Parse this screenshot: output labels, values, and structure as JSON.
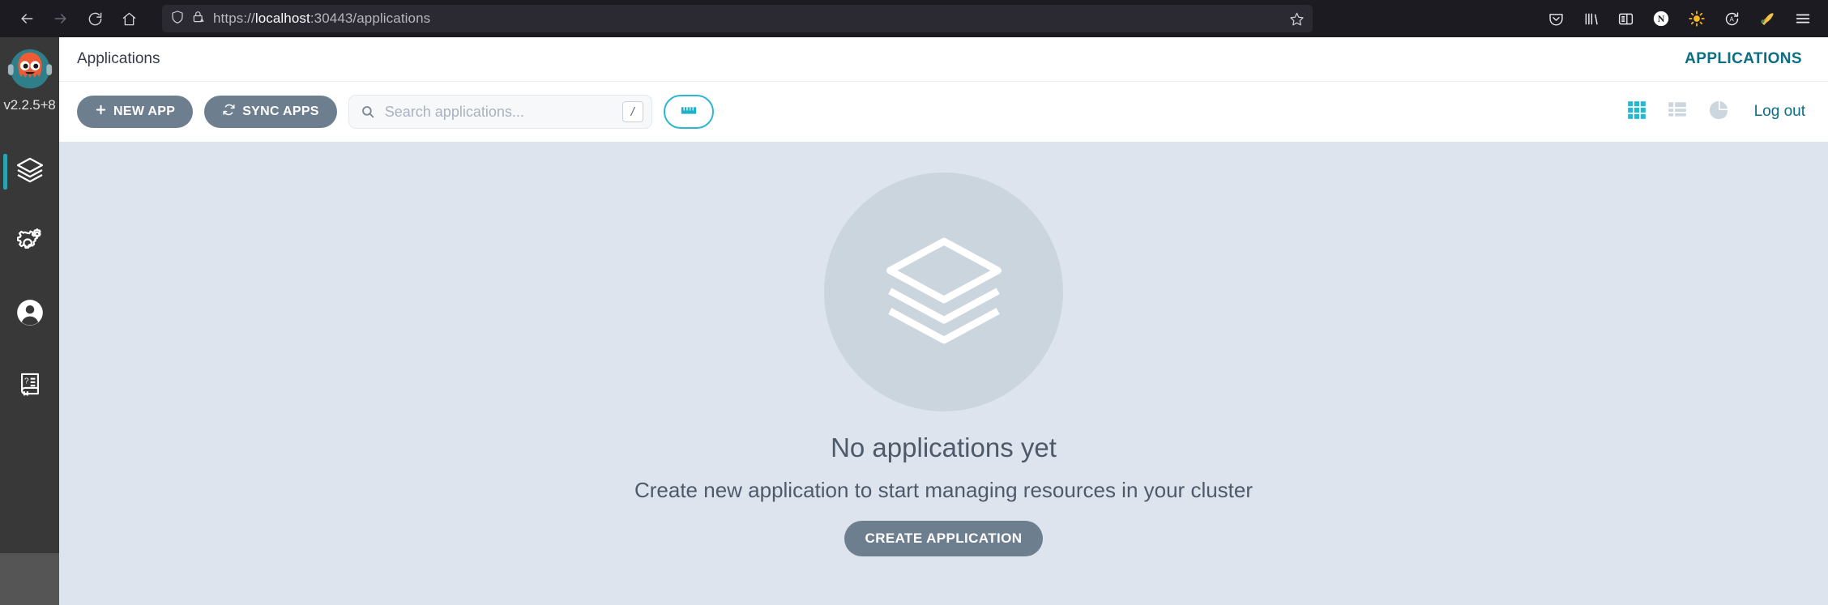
{
  "browser": {
    "back_label": "Back",
    "forward_label": "Forward",
    "reload_label": "Reload",
    "home_label": "Home",
    "url_scheme": "https://",
    "url_host": "localhost",
    "url_path": ":30443/applications",
    "full_url": "https://localhost:30443/applications",
    "bookmark_label": "Bookmark this page",
    "toolbar_icons": [
      {
        "name": "pocket-icon",
        "label": "Save to Pocket"
      },
      {
        "name": "library-icon",
        "label": "Library"
      },
      {
        "name": "sidebar-icon",
        "label": "Sidebars"
      },
      {
        "name": "notion-extension-icon",
        "label": "N"
      },
      {
        "name": "theme-sun-icon",
        "label": "Theme"
      },
      {
        "name": "translate-icon",
        "label": "Translate"
      },
      {
        "name": "extension-icon",
        "label": "Extension"
      },
      {
        "name": "app-menu-icon",
        "label": "Open application menu"
      }
    ]
  },
  "sidebar": {
    "brand": {
      "logo_name": "argo-octopus-logo",
      "version": "v2.2.5+8"
    },
    "items": [
      {
        "label": "Applications",
        "icon": "layers-icon",
        "active": true
      },
      {
        "label": "Settings",
        "icon": "gears-icon",
        "active": false
      },
      {
        "label": "User Info",
        "icon": "user-circle-icon",
        "active": false
      },
      {
        "label": "Documentation",
        "icon": "book-icon",
        "active": false
      }
    ]
  },
  "header": {
    "breadcrumb": "Applications",
    "right_title": "APPLICATIONS"
  },
  "toolbar": {
    "new_app_label": "NEW APP",
    "new_app_icon": "plus-icon",
    "sync_apps_label": "SYNC APPS",
    "sync_apps_icon": "sync-refresh-icon",
    "search_placeholder": "Search applications...",
    "search_value": "",
    "search_icon": "search-icon",
    "search_shortcut": "/",
    "filter_icon": "filter-ruler-icon",
    "views": [
      {
        "name": "tiles-view-icon",
        "label": "Tiles",
        "active": true
      },
      {
        "name": "list-view-icon",
        "label": "List",
        "active": false
      },
      {
        "name": "summary-pie-view-icon",
        "label": "Summary",
        "active": false
      }
    ],
    "logout_label": "Log out"
  },
  "empty_state": {
    "icon": "layers-stack-icon",
    "title": "No applications yet",
    "subtitle": "Create new application to start managing resources in your cluster",
    "cta_label": "CREATE APPLICATION"
  },
  "colors": {
    "accent_teal": "#0a6e84",
    "accent_cyan": "#2bb7d1",
    "button_slate": "#6d7f8f",
    "content_bg": "#dde4ed",
    "sidebar_bg": "#383838",
    "chrome_bg": "#1c1b22"
  }
}
